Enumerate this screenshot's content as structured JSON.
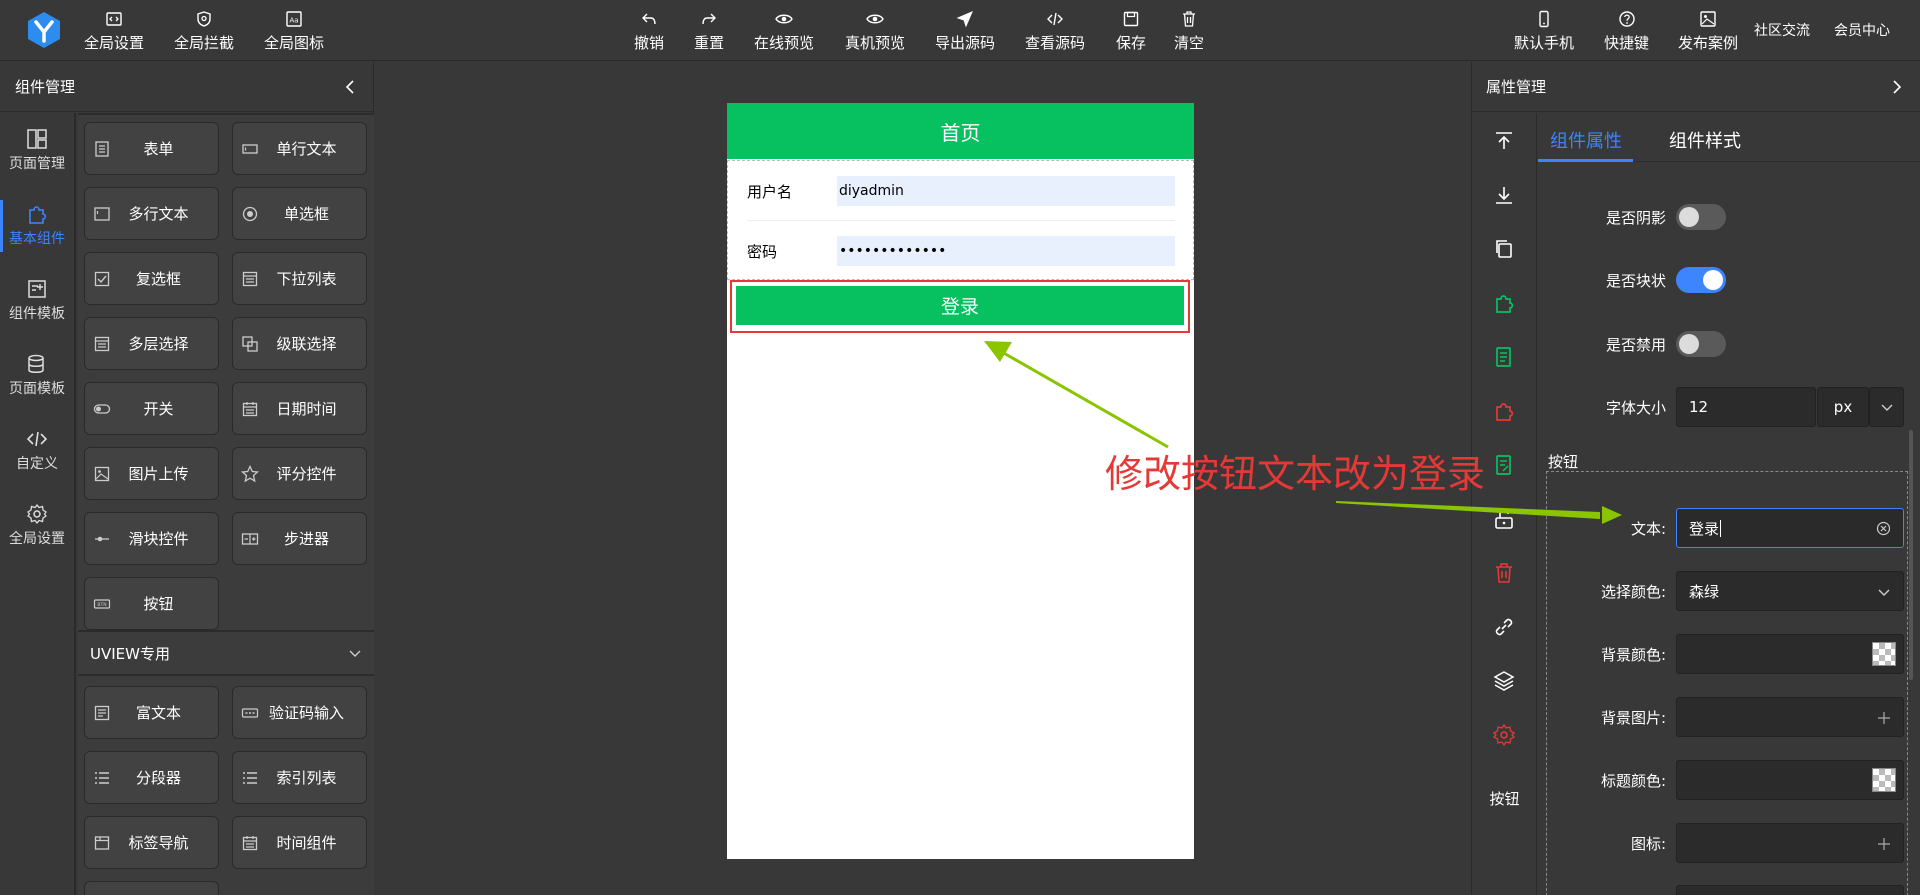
{
  "topbar": {
    "left_buttons": [
      {
        "label": "全局设置",
        "icon": "settings-code-icon"
      },
      {
        "label": "全局拦截",
        "icon": "shield-icon"
      },
      {
        "label": "全局图标",
        "icon": "icon-library-icon"
      }
    ],
    "center_buttons": [
      {
        "label": "撤销",
        "icon": "undo-icon"
      },
      {
        "label": "重置",
        "icon": "redo-icon"
      },
      {
        "label": "在线预览",
        "icon": "eye-icon"
      },
      {
        "label": "真机预览",
        "icon": "eye-icon"
      },
      {
        "label": "导出源码",
        "icon": "send-icon"
      },
      {
        "label": "查看源码",
        "icon": "code-icon"
      },
      {
        "label": "保存",
        "icon": "save-icon"
      },
      {
        "label": "清空",
        "icon": "trash-icon"
      }
    ],
    "right_buttons": [
      {
        "label": "默认手机",
        "icon": "phone-icon"
      },
      {
        "label": "快捷键",
        "icon": "help-icon"
      },
      {
        "label": "发布案例",
        "icon": "image-icon"
      }
    ],
    "right_links": [
      "社区交流",
      "会员中心"
    ]
  },
  "left_panel": {
    "title": "组件管理",
    "nav": [
      {
        "label": "页面管理",
        "icon": "layout-icon"
      },
      {
        "label": "基本组件",
        "icon": "puzzle-icon"
      },
      {
        "label": "组件模板",
        "icon": "template-icon"
      },
      {
        "label": "页面模板",
        "icon": "database-icon"
      },
      {
        "label": "自定义",
        "icon": "code-icon"
      },
      {
        "label": "全局设置",
        "icon": "gear-icon"
      }
    ],
    "active_nav": "基本组件",
    "components": [
      "表单",
      "单行文本",
      "多行文本",
      "单选框",
      "复选框",
      "下拉列表",
      "多层选择",
      "级联选择",
      "开关",
      "日期时间",
      "图片上传",
      "评分控件",
      "滑块控件",
      "步进器",
      "按钮"
    ],
    "uview_title": "UVIEW专用",
    "uview_components": [
      "富文本",
      "验证码输入",
      "分段器",
      "索引列表",
      "标签导航",
      "时间组件"
    ]
  },
  "canvas": {
    "header_title": "首页",
    "form": {
      "username_label": "用户名",
      "username_value": "diyadmin",
      "password_label": "密码",
      "password_value": "•••••••••••••"
    },
    "button_text": "登录"
  },
  "annotation": "修改按钮文本改为登录",
  "right_panel": {
    "title": "属性管理",
    "tabs": [
      "组件属性",
      "组件样式"
    ],
    "active_tab": "组件属性",
    "tool_label": "按钮",
    "props": {
      "shadow_label": "是否阴影",
      "shadow_on": false,
      "block_label": "是否块状",
      "block_on": true,
      "disabled_label": "是否禁用",
      "disabled_on": false,
      "font_size_label": "字体大小",
      "font_size_value": "12",
      "font_size_unit": "px"
    },
    "button_section": {
      "title": "按钮",
      "text_label": "文本:",
      "text_value": "登录",
      "color_label": "选择颜色:",
      "color_value": "森绿",
      "bg_color_label": "背景颜色:",
      "bg_image_label": "背景图片:",
      "title_color_label": "标题颜色:",
      "icon_label": "图标:"
    }
  },
  "colors": {
    "accent": "#3d84ff",
    "brand_green": "#07c160",
    "annotation_red": "#e53935",
    "arrow_green": "#8bc400"
  }
}
